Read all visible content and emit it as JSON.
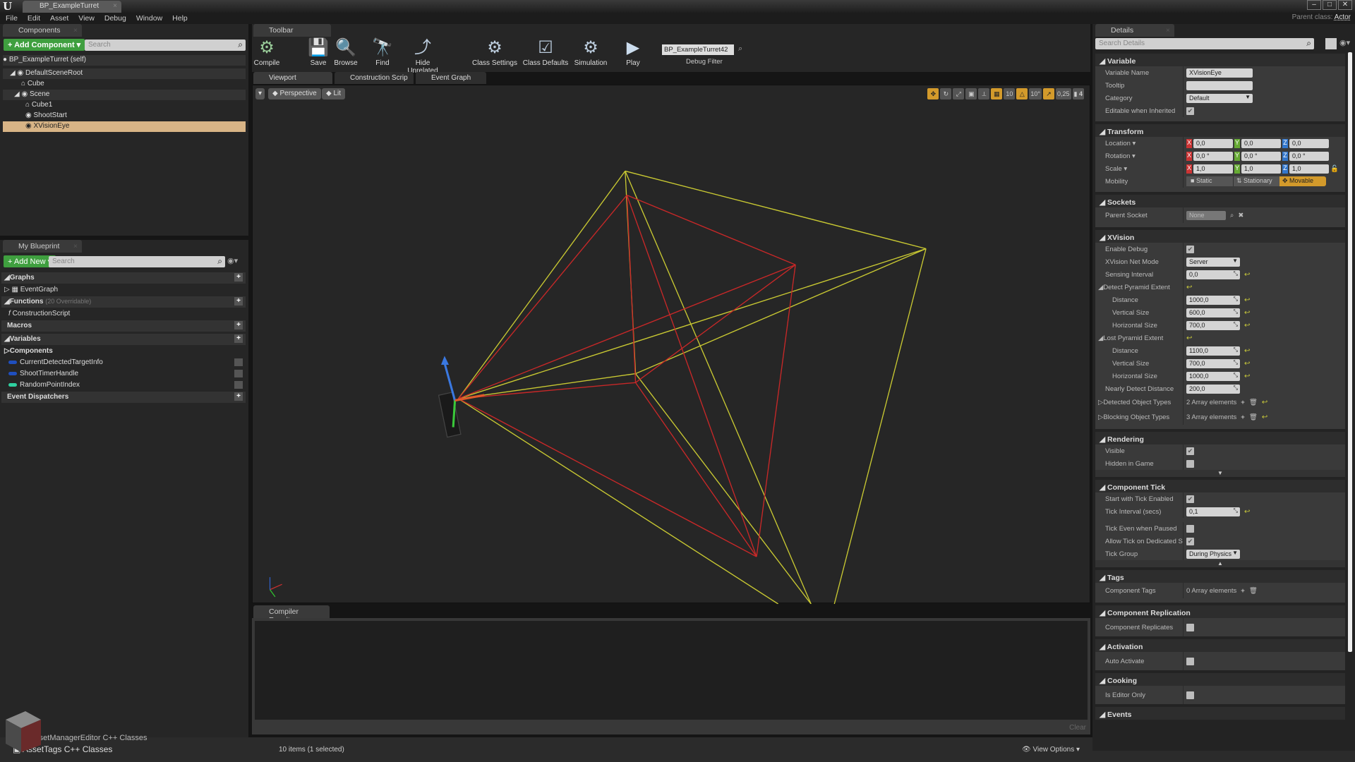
{
  "window": {
    "tab_title": "BP_ExampleTurret",
    "parent_class_label": "Parent class:",
    "parent_class": "Actor",
    "controls": [
      "–",
      "□",
      "✕"
    ]
  },
  "menu": [
    "File",
    "Edit",
    "Asset",
    "View",
    "Debug",
    "Window",
    "Help"
  ],
  "components_panel": {
    "tab": "Components",
    "add_button": "+ Add Component ▾",
    "search_placeholder": "Search",
    "self": "BP_ExampleTurret (self)",
    "tree": [
      {
        "label": "DefaultSceneRoot",
        "depth": 0
      },
      {
        "label": "Cube",
        "depth": 1
      },
      {
        "label": "Scene",
        "depth": 1
      },
      {
        "label": "Cube1",
        "depth": 2
      },
      {
        "label": "ShootStart",
        "depth": 2
      },
      {
        "label": "XVisionEye",
        "depth": 2,
        "selected": true
      }
    ]
  },
  "my_blueprint": {
    "tab": "My Blueprint",
    "add_button": "+ Add New ▾",
    "search_placeholder": "Search",
    "graphs": "Graphs",
    "event_graph": "EventGraph",
    "functions": "Functions",
    "functions_note": "(20 Overridable)",
    "construction_script": "ConstructionScript",
    "macros": "Macros",
    "variables": "Variables",
    "components": "Components",
    "vars": [
      {
        "name": "CurrentDetectedTargetInfo",
        "color": "#1f4fbf"
      },
      {
        "name": "ShootTimerHandle",
        "color": "#1f4fbf"
      },
      {
        "name": "RandomPointIndex",
        "color": "#2fd0a0"
      }
    ],
    "event_dispatchers": "Event Dispatchers"
  },
  "toolbar": {
    "tab": "Toolbar",
    "buttons": [
      "Compile",
      "Save",
      "Browse",
      "Find",
      "Hide Unrelated",
      "Class Settings",
      "Class Defaults",
      "Simulation",
      "Play"
    ],
    "debug_filter_value": "BP_ExampleTurret42 ▾",
    "debug_filter_label": "Debug Filter"
  },
  "editor_tabs": [
    "Viewport",
    "Construction Scrip",
    "Event Graph"
  ],
  "viewport": {
    "perspective": "Perspective",
    "lit": "Lit",
    "snap": {
      "grid": "10",
      "rotation": "10°",
      "scale": "0,25",
      "camera_speed": "4"
    },
    "colors": {
      "detect": "#c8c832",
      "lost": "#c82828"
    }
  },
  "compiler": {
    "tab": "Compiler Results",
    "clear": "Clear"
  },
  "content_browser": {
    "folders": [
      "AssetManagerEditor C++ Classes",
      "AssetTags C++ Classes"
    ],
    "status": "10 items (1 selected)",
    "view_options": "View Options ▾"
  },
  "details": {
    "tab": "Details",
    "search_placeholder": "Search Details",
    "variable": {
      "title": "Variable",
      "name_label": "Variable Name",
      "name": "XVisionEye",
      "tooltip_label": "Tooltip",
      "tooltip": "",
      "category_label": "Category",
      "category": "Default",
      "editable_label": "Editable when Inherited"
    },
    "transform": {
      "title": "Transform",
      "location_label": "Location ▾",
      "location": [
        "0,0",
        "0,0",
        "0,0"
      ],
      "rotation_label": "Rotation ▾",
      "rotation": [
        "0,0 °",
        "0,0 °",
        "0,0 °"
      ],
      "scale_label": "Scale ▾",
      "scale": [
        "1,0",
        "1,0",
        "1,0"
      ],
      "mobility_label": "Mobility",
      "mobility": [
        "Static",
        "Stationary",
        "Movable"
      ],
      "mobility_selected": "Movable"
    },
    "sockets": {
      "title": "Sockets",
      "parent_label": "Parent Socket",
      "parent": "None"
    },
    "xvision": {
      "title": "XVision",
      "enable_debug": "Enable Debug",
      "net_mode_label": "XVision Net Mode",
      "net_mode": "Server",
      "sensing_label": "Sensing Interval",
      "sensing": "0,0",
      "detect_label": "Detect Pyramid Extent",
      "detect": [
        {
          "label": "Distance",
          "value": "1000,0"
        },
        {
          "label": "Vertical Size",
          "value": "600,0"
        },
        {
          "label": "Horizontal Size",
          "value": "700,0"
        }
      ],
      "lost_label": "Lost Pyramid Extent",
      "lost": [
        {
          "label": "Distance",
          "value": "1100,0"
        },
        {
          "label": "Vertical Size",
          "value": "700,0"
        },
        {
          "label": "Horizontal Size",
          "value": "1000,0"
        }
      ],
      "nearly_label": "Nearly Detect Distance",
      "nearly": "200,0",
      "detected_types_label": "Detected Object Types",
      "detected_types": "2 Array elements",
      "blocking_types_label": "Blocking Object Types",
      "blocking_types": "3 Array elements"
    },
    "rendering": {
      "title": "Rendering",
      "visible": "Visible",
      "hidden": "Hidden in Game"
    },
    "tick": {
      "title": "Component Tick",
      "start": "Start with Tick Enabled",
      "interval_label": "Tick Interval (secs)",
      "interval": "0,1",
      "paused": "Tick Even when Paused",
      "dedicated": "Allow Tick on Dedicated Serve",
      "group_label": "Tick Group",
      "group": "During Physics"
    },
    "tags": {
      "title": "Tags",
      "label": "Component Tags",
      "value": "0 Array elements"
    },
    "replication": {
      "title": "Component Replication",
      "label": "Component Replicates"
    },
    "activation": {
      "title": "Activation",
      "label": "Auto Activate"
    },
    "cooking": {
      "title": "Cooking",
      "label": "Is Editor Only"
    },
    "events": {
      "title": "Events"
    }
  }
}
